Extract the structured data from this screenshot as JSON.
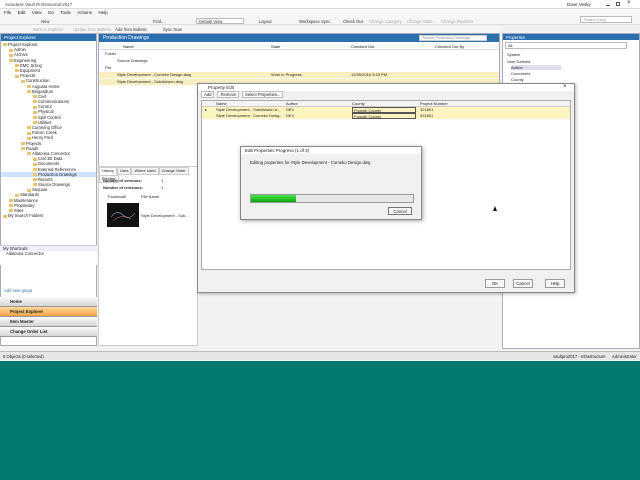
{
  "window": {
    "title": "Autodesk Vault Professional 2017",
    "user": "Dave Vesky"
  },
  "menu": [
    "File",
    "Edit",
    "View",
    "Go",
    "Tools",
    "Actions",
    "Help"
  ],
  "toolbar": {
    "new": "New",
    "find": "Find...",
    "default_view": "Default View",
    "layout": "Layout",
    "workspace_sync": "Workspace Sync",
    "check_out": "Check Out",
    "check_in": "Check In",
    "change_category": "Change Category",
    "change_state": "Change State",
    "change_revision": "Change Revision",
    "help_placeholder": "Search Help",
    "back": "Back to Explorer",
    "update": "Update from Bulletin",
    "add_from_bulletin": "Add from Bulletin",
    "sync_now": "Sync Now"
  },
  "project_explorer": {
    "title": "Project Explorer",
    "tree": [
      "Project Explorer",
      "Admin",
      "Archive",
      "Engineering",
      "EMC Sizing",
      "Equipment",
      "Projects",
      "Construction",
      "Augusta Home",
      "Belgardium",
      "Civil",
      "Communications",
      "Control",
      "Physical",
      "Spill Control",
      "Utilities",
      "Cumming Office",
      "Falcon Creek",
      "Henry Ford",
      "Projects",
      "Roads",
      "Allatoona Connector",
      "Civil 3D Data",
      "Documents",
      "External References",
      "Production Drawings",
      "Reports",
      "Source Drawings",
      "Sequoia",
      "Standards",
      "Maintenance",
      "Proprietary",
      "Sites",
      "My Search Folders"
    ],
    "shortcuts_title": "My Shortcuts",
    "shortcut": "Allatoona Connector",
    "add_group": "Add new group",
    "nav": [
      "Home",
      "Project Explorer",
      "Item Master",
      "Change Order List"
    ]
  },
  "main": {
    "title": "Production Drawings",
    "search_placeholder": "Search Production Drawings",
    "columns": [
      "Name",
      "State",
      "Checked Out",
      "Checked Out By"
    ],
    "rows": [
      {
        "name": "Folder",
        "state": "",
        "checked": "",
        "by": ""
      },
      {
        "name": "Source Drawings",
        "state": "",
        "checked": "",
        "by": ""
      },
      {
        "name": "File",
        "state": "",
        "checked": "",
        "by": ""
      },
      {
        "name": "Style Development - Comeko Design.dwg",
        "state": "Work in Progress",
        "checked": "12/30/2016 3:53 PM",
        "by": ""
      },
      {
        "name": "Style Development - Subdivision.dwg",
        "state": "",
        "checked": "",
        "by": ""
      }
    ]
  },
  "history": {
    "tabs": [
      "History",
      "Uses",
      "Where Used",
      "Change Order",
      "Preview"
    ],
    "versions_label": "Number of versions:",
    "versions_value": "1",
    "revisions_label": "Number of revisions:",
    "revisions_value": "1",
    "cols": [
      "Thumbnail",
      "File Name"
    ],
    "file": "Style Development - Sub..."
  },
  "properties": {
    "title": "Properties",
    "select": "All",
    "groups": [
      "System",
      "User Defined",
      "Author",
      "Comments",
      "County"
    ]
  },
  "property_edit": {
    "title": "Property Edit",
    "tool": [
      "Add",
      "Remove",
      "Select Properties..."
    ],
    "columns": [
      "Name",
      "Author",
      "County",
      "Project Number"
    ],
    "rows": [
      {
        "name": "Style Development - Subdivision.d...",
        "author": "DEV",
        "county": "Forsyth County",
        "project": "321801"
      },
      {
        "name": "Style Development - Comeko Desig...",
        "author": "DEV",
        "county": "Forsyth County",
        "project": "321801"
      }
    ],
    "ok": "OK",
    "cancel": "Cancel",
    "help": "Help"
  },
  "progress_dialog": {
    "title": "Edit Properties Progress (1 of 2)",
    "message": "Editing properties for Style Development - Comeko Design.dwg",
    "progress": 0.28,
    "cancel": "Cancel"
  },
  "status": {
    "left": "0 Objects (0 selected)",
    "server": "vaultpro2017 - Infrastructure",
    "user": "Administrator"
  },
  "colors": {
    "accent": "#2a6fb0",
    "desktop": "#00796f",
    "progress": "#22c322"
  }
}
